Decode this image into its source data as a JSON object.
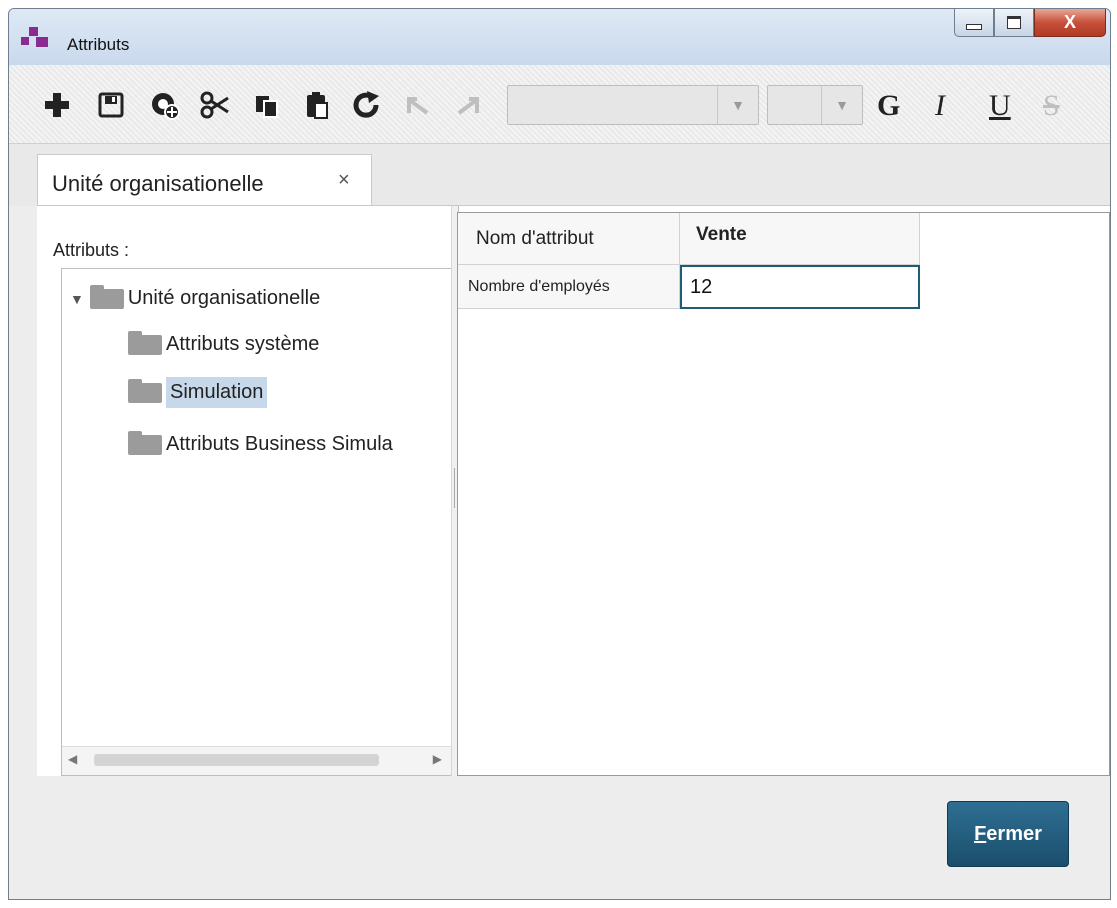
{
  "window": {
    "title": "Attributs",
    "close_glyph": "X"
  },
  "toolbar": {
    "buttons": [
      "add-icon",
      "save-icon",
      "add-element-icon",
      "cut-icon",
      "copy-icon",
      "paste-icon",
      "refresh-icon",
      "undo-icon",
      "redo-icon"
    ],
    "font_combo_value": "",
    "size_combo_value": "",
    "bold_label": "G",
    "italic_label": "I",
    "underline_label": "U",
    "strike_label": "S"
  },
  "tab": {
    "label": "Unité organisationelle",
    "close": "×"
  },
  "left": {
    "label": "Attributs :",
    "tree": [
      {
        "label": "Unité organisationelle",
        "expanded": true
      },
      {
        "label": "Attributs système"
      },
      {
        "label": "Simulation",
        "selected": true
      },
      {
        "label": "Attributs Business Simula"
      }
    ]
  },
  "grid": {
    "header_label": "Nom d'attribut",
    "header_value": "Vente",
    "row_label": "Nombre d'employés",
    "row_value": "12"
  },
  "footer": {
    "close_first": "F",
    "close_rest": "ermer"
  },
  "colors": {
    "accent": "#1b4e6c",
    "selection": "#c6d8ea",
    "close_button": "#c7503a",
    "brand_icon": "#8a2c8f"
  }
}
